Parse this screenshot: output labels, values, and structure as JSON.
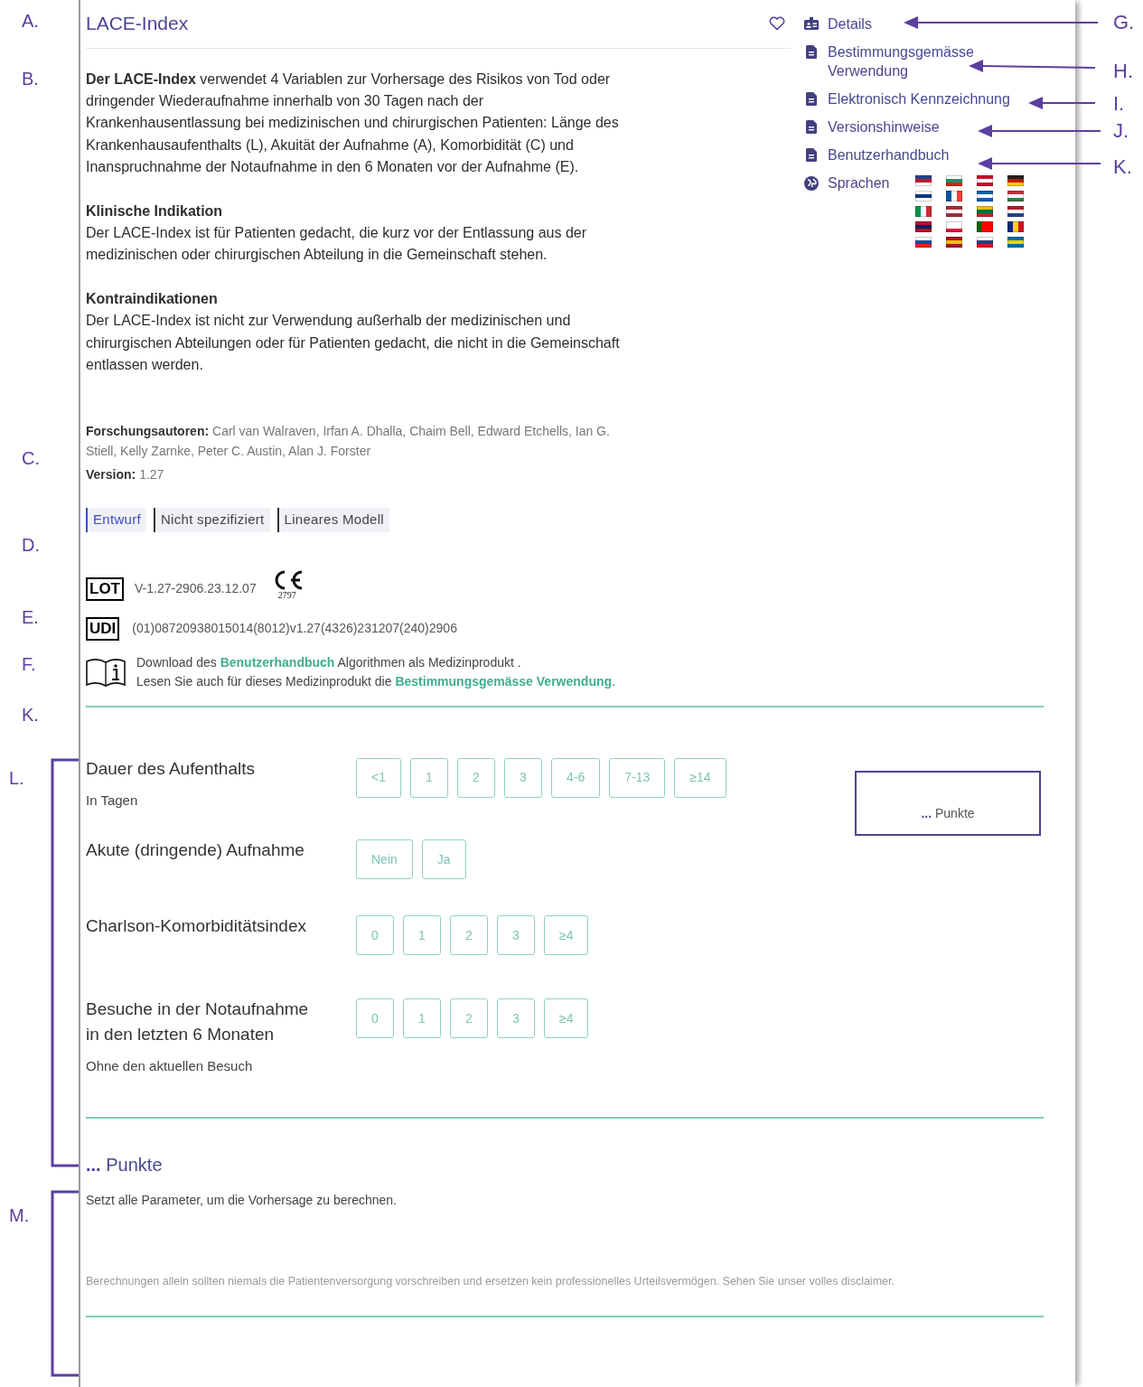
{
  "markers": [
    "A.",
    "B.",
    "C.",
    "D.",
    "E.",
    "F.",
    "K.",
    "L.",
    "M."
  ],
  "side_markers": [
    "G.",
    "H.",
    "I.",
    "J.",
    "K."
  ],
  "title": "LACE-Index",
  "intro": "**Der LACE-Index** verwendet 4 Variablen zur Vorhersage des Risikos von Tod oder dringender Wiederaufnahme innerhalb von 30 Tagen nach der Krankenhausentlassung bei medizinischen und chirurgischen Patienten: Länge des Krankenhausaufenthalts (L), Akuität der Aufnahme (A), Komorbidität (C) und Inanspruchnahme der Notaufnahme in den 6 Monaten vor der Aufnahme (E).",
  "sections": [
    {
      "heading": "Klinische Indikation",
      "text": "Der LACE-Index ist für Patienten gedacht, die kurz vor der Entlassung aus der medizinischen oder chirurgischen Abteilung in die Gemeinschaft stehen."
    },
    {
      "heading": "Kontraindikationen",
      "text": "Der LACE-Index ist nicht zur Verwendung außerhalb der medizinischen und chirurgischen Abteilungen oder für Patienten gedacht, die nicht in die Gemeinschaft entlassen werden."
    }
  ],
  "authors": {
    "label": "Forschungsautoren:",
    "value": "Carl van Walraven, Irfan A. Dhalla, Chaim Bell, Edward Etchells, Ian G. Stiell, Kelly Zarnke, Peter C. Austin, Alan J. Forster"
  },
  "version": {
    "label": "Version:",
    "value": "1.27"
  },
  "tags": [
    {
      "label": "Entwurf",
      "color": "#3b4cc0"
    },
    {
      "label": "Nicht spezifiziert",
      "color": "#333333"
    },
    {
      "label": "Lineares Modell",
      "color": "#333333"
    }
  ],
  "lot": {
    "symbol": "LOT",
    "value": "V-1.27-2906.23.12.07",
    "ce_number": "2797"
  },
  "udi": {
    "symbol": "UDI",
    "value": "(01)08720938015014(8012)v1.27(4326)231207(240)2906"
  },
  "manual_note": [
    {
      "before": "Download des",
      "link": "Benutzerhandbuch",
      "after": " Algorithmen als Medizinprodukt ."
    },
    {
      "before": "Lesen Sie auch für dieses Medizinprodukt die",
      "link": "Bestimmungsgemässe Verwendung",
      "after": "."
    }
  ],
  "sidebar": [
    {
      "kind": "details",
      "label": "Details"
    },
    {
      "kind": "document",
      "label": "Bestimmungsgemässe Verwendung"
    },
    {
      "kind": "document",
      "label": "Elektronisch Kennzeichnung"
    },
    {
      "kind": "document",
      "label": "Versionshinweise"
    },
    {
      "kind": "document",
      "label": "Benutzerhandbuch"
    },
    {
      "kind": "languages",
      "label": "Sprachen"
    }
  ],
  "inputs": [
    {
      "label": "Dauer des Aufenthalts",
      "hint": "In Tagen",
      "options": [
        {
          "label": "<1",
          "selected": false
        },
        {
          "label": "1",
          "selected": false
        },
        {
          "label": "2",
          "selected": false
        },
        {
          "label": "3",
          "selected": false
        },
        {
          "label": "4-6",
          "selected": false
        },
        {
          "label": "7-13",
          "selected": false
        },
        {
          "label": "≥14",
          "selected": false
        }
      ]
    },
    {
      "label": "Akute (dringende) Aufnahme",
      "options": [
        {
          "label": "Nein",
          "selected": false
        },
        {
          "label": "Ja",
          "selected": false
        }
      ]
    },
    {
      "label": "Charlson-Komorbiditätsindex",
      "options": [
        {
          "label": "0",
          "selected": false
        },
        {
          "label": "1",
          "selected": false
        },
        {
          "label": "2",
          "selected": false
        },
        {
          "label": "3",
          "selected": false
        },
        {
          "label": "≥4",
          "selected": false
        }
      ]
    },
    {
      "label": "Besuche in der Notaufnahme in den letzten 6 Monaten",
      "hint": "Ohne den aktuellen Besuch",
      "options": [
        {
          "label": "0",
          "selected": false
        },
        {
          "label": "1",
          "selected": false
        },
        {
          "label": "2",
          "selected": false
        },
        {
          "label": "3",
          "selected": false
        },
        {
          "label": "≥4",
          "selected": false
        }
      ]
    }
  ],
  "score_box": {
    "dots": "...",
    "label": "Punkte"
  },
  "result": {
    "dots": "...",
    "label": "Punkte",
    "message": "Setzt alle Parameter, um die Vorhersage zu berechnen.",
    "disclaimer": "Berechnungen allein sollten niemals die Patientenversorgung vorschreiben und ersetzen kein professionelles Urteilsvermögen. Sehen Sie unser volles disclaimer."
  }
}
